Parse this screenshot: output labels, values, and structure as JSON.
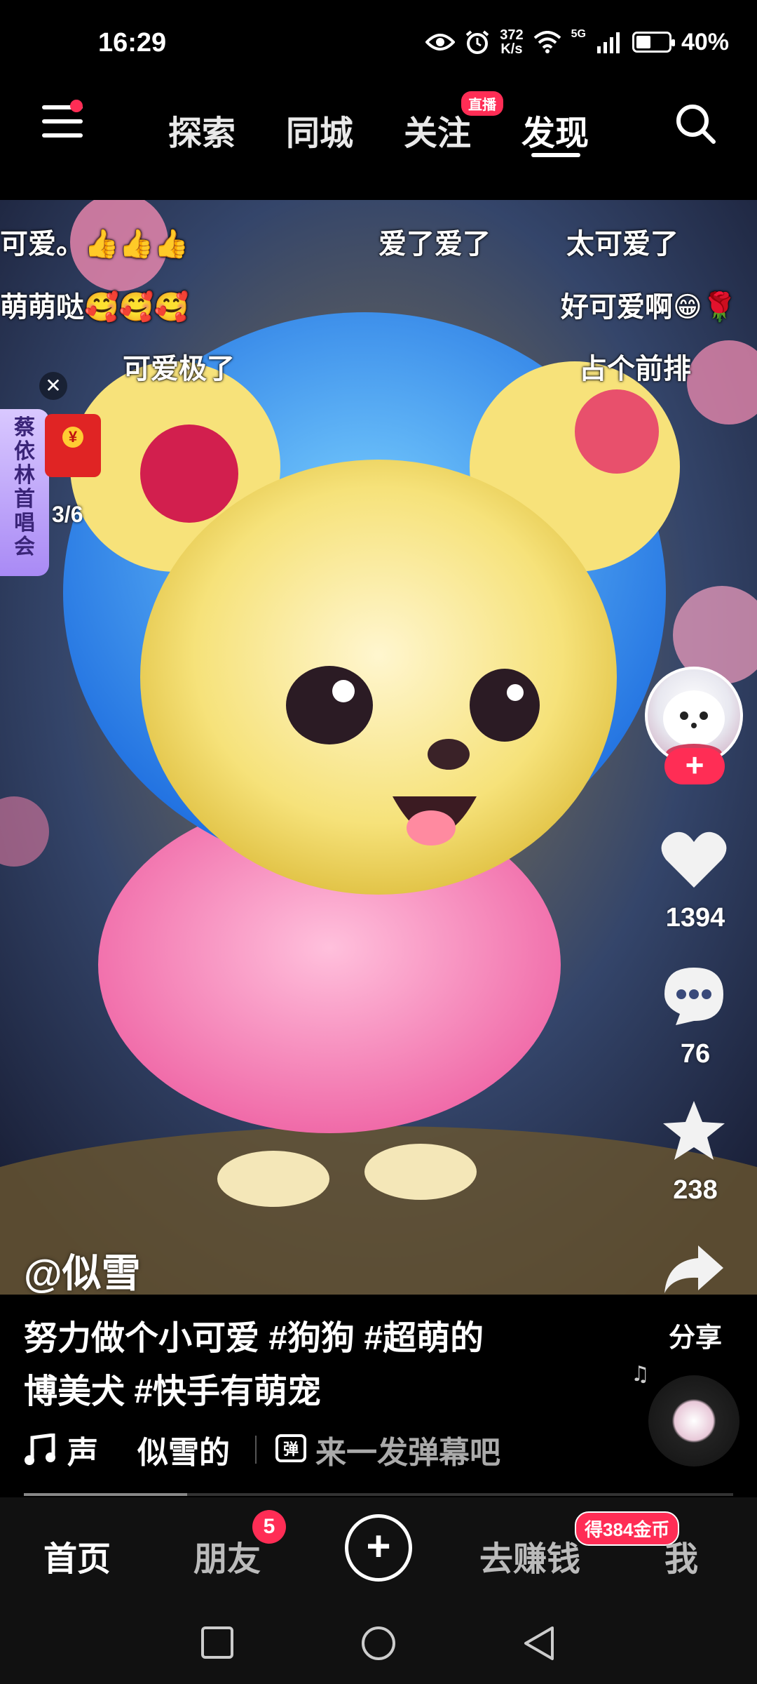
{
  "status_bar": {
    "time": "16:29",
    "net_speed_value": "372",
    "net_speed_unit": "K/s",
    "network": "5G",
    "battery": "40%",
    "battery_level": 0.4
  },
  "top_nav": {
    "tabs": [
      "探索",
      "同城",
      "关注",
      "发现"
    ],
    "active_tab": "发现",
    "live_badge": "直播"
  },
  "danmaku": [
    "可爱。👍👍👍",
    "爱了爱了",
    "太可爱了",
    "萌萌哒🥰🥰🥰",
    "好可爱啊😁🌹",
    "可爱极了",
    "占个前排"
  ],
  "concert_badge": "蔡依林首唱会",
  "red_packet_count": "3/6",
  "actions": {
    "likes": "1394",
    "comments": "76",
    "favorites": "238",
    "share": "分享"
  },
  "author": "@似雪",
  "caption_line1": "努力做个小可爱 #狗狗 #超萌的",
  "caption_line2": "博美犬 #快手有萌宠",
  "music": {
    "sound": "声",
    "source": "似雪的",
    "danmaku_placeholder": "来一发弹幕吧"
  },
  "playback_progress": 0.23,
  "bottom_nav": {
    "home": "首页",
    "friends": "朋友",
    "friends_badge": "5",
    "earn": "去赚钱",
    "earn_badge": "得384金币",
    "me": "我"
  },
  "colors": {
    "accent": "#ff2d55",
    "background": "#000000"
  }
}
